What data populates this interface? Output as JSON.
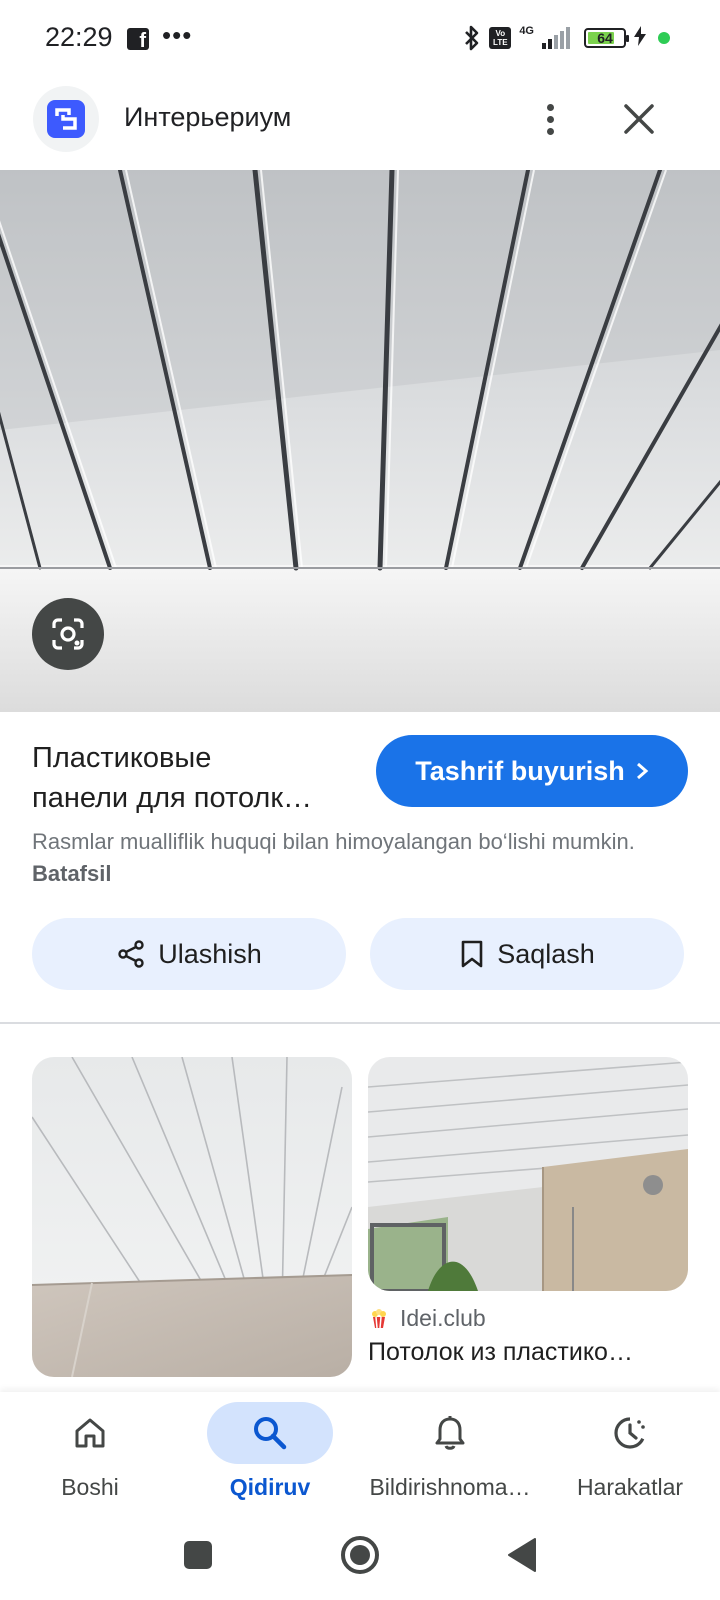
{
  "status_bar": {
    "time": "22:29",
    "battery_level": "64",
    "network": "4G",
    "volte": "Vo LTE",
    "icons": [
      "facebook-icon",
      "more-dots",
      "bluetooth-icon",
      "volte-icon",
      "signal-icon",
      "battery-icon",
      "charging-icon",
      "green-dot"
    ]
  },
  "header": {
    "site_name": "Интерьериум",
    "icons": [
      "site-logo-icon",
      "more-vert-icon",
      "close-icon"
    ]
  },
  "result": {
    "title_line1": "Пластиковые",
    "title_line2": "панели для потолк…",
    "visit_label": "Tashrif buyurish",
    "copyright_text": "Rasmlar mualliflik huquqi bilan himoyalangan bo‘lishi mumkin.",
    "copyright_link": "Batafsil",
    "share_label": "Ulashish",
    "save_label": "Saqlash",
    "accent_color": "#1a73e8"
  },
  "related": {
    "source_name": "Idei.club",
    "title": "Потолок из пластико…"
  },
  "bottom_nav": {
    "items": [
      {
        "label": "Boshi",
        "icon": "home-icon",
        "active": false
      },
      {
        "label": "Qidiruv",
        "icon": "search-icon",
        "active": true
      },
      {
        "label": "Bildirishnoma…",
        "icon": "bell-icon",
        "active": false
      },
      {
        "label": "Harakatlar",
        "icon": "activity-icon",
        "active": false
      }
    ],
    "active_color": "#0b57d0"
  },
  "system_nav": {
    "icons": [
      "recents-square-icon",
      "home-circle-icon",
      "back-triangle-icon"
    ]
  }
}
